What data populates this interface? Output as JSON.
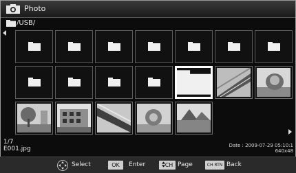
{
  "header": {
    "title": "Photo",
    "title_icon": "camera-icon"
  },
  "path": {
    "text": "/USB/",
    "icon": "folder-icon"
  },
  "grid": {
    "folder_icon": "folder-icon",
    "selected_index": 11
  },
  "info": {
    "counter": "1/7",
    "filename": "E001.jpg",
    "date": "Date : 2009-07-29 05:10:1",
    "resolution": "640x48"
  },
  "help": {
    "select_label": "Select",
    "ok_key": "OK",
    "enter_label": "Enter",
    "ch_key": "CH",
    "page_label": "Page",
    "chrtn_key": "CH RTN",
    "back_label": "Back"
  }
}
